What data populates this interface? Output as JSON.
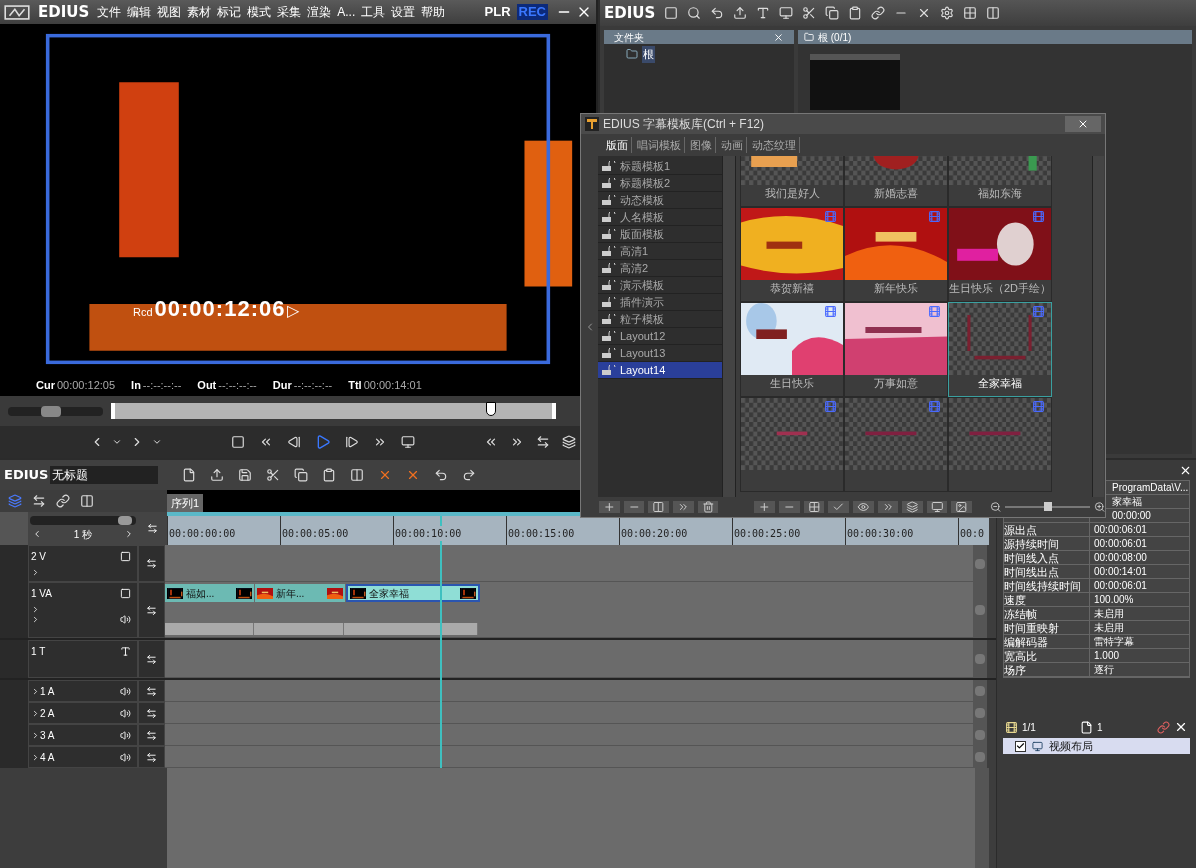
{
  "player": {
    "brand": "EDIUS",
    "menu": [
      "文件",
      "编辑",
      "视图",
      "素材",
      "标记",
      "模式",
      "采集",
      "渲染",
      "A...",
      "工具",
      "设置",
      "帮助"
    ],
    "modes": [
      {
        "label": "PLR",
        "selected": false
      },
      {
        "label": "REC",
        "selected": true
      }
    ],
    "overlay": {
      "label": "Rcd",
      "value": "00:00:12:06",
      "marker": "▷"
    },
    "timecodes": [
      {
        "label": "Cur",
        "value": "00:00:12:05"
      },
      {
        "label": "In",
        "value": "--:--:--:--"
      },
      {
        "label": "Out",
        "value": "--:--:--:--"
      },
      {
        "label": "Dur",
        "value": "--:--:--:--"
      },
      {
        "label": "Ttl",
        "value": "00:00:14:01"
      }
    ],
    "shuttle": {
      "level": 0.45
    },
    "scrubber": {
      "level": 0.86
    }
  },
  "bin": {
    "brand": "EDIUS",
    "folder_panel": {
      "title": "文件夹",
      "items": [
        {
          "label": "根"
        }
      ]
    },
    "clip_panel": {
      "title": "根 (0/1)"
    }
  },
  "template_library": {
    "title": "EDIUS 字幕模板库(Ctrl + F12)",
    "tabs": [
      {
        "label": "版面",
        "selected": true
      },
      {
        "label": "唱词模板",
        "selected": false
      },
      {
        "label": "图像",
        "selected": false
      },
      {
        "label": "动画",
        "selected": false
      },
      {
        "label": "动态纹理",
        "selected": false
      }
    ],
    "categories": [
      {
        "label": "标题模板1",
        "selected": false
      },
      {
        "label": "标题模板2",
        "selected": false
      },
      {
        "label": "动态模板",
        "selected": false
      },
      {
        "label": "人名模板",
        "selected": false
      },
      {
        "label": "版面模板",
        "selected": false
      },
      {
        "label": "高清1",
        "selected": false
      },
      {
        "label": "高清2",
        "selected": false
      },
      {
        "label": "演示模板",
        "selected": false
      },
      {
        "label": "插件演示",
        "selected": false
      },
      {
        "label": "粒子模板",
        "selected": false
      },
      {
        "label": "Layout12",
        "selected": false
      },
      {
        "label": "Layout13",
        "selected": false
      },
      {
        "label": "Layout14",
        "selected": true
      }
    ],
    "templates": [
      {
        "label": "我们是好人",
        "selected": false
      },
      {
        "label": "新婚志喜",
        "selected": false
      },
      {
        "label": "福如东海",
        "selected": false
      },
      {
        "label": "恭贺新禧",
        "selected": false
      },
      {
        "label": "新年快乐",
        "selected": false
      },
      {
        "label": "生日快乐（2D手绘）",
        "selected": false
      },
      {
        "label": "生日快乐",
        "selected": false
      },
      {
        "label": "万事如意",
        "selected": false
      },
      {
        "label": "全家幸福",
        "selected": true
      },
      {
        "selected": false
      },
      {
        "selected": false
      },
      {
        "selected": false
      }
    ],
    "zoom": {
      "level": 0.5
    }
  },
  "timeline": {
    "brand": "EDIUS",
    "project_name": "无标题",
    "sequence_tabs": [
      {
        "label": "序列1",
        "selected": true
      }
    ],
    "zoom": "1 秒",
    "zoom_slider": {
      "level": 0.9
    },
    "ruler": [
      "00:00:00:00",
      "00:00:05:00",
      "00:00:10:00",
      "00:00:15:00",
      "00:00:20:00",
      "00:00:25:00",
      "00:00:30:00",
      "00:0"
    ],
    "playhead": {
      "level": 0.338
    },
    "tracks": [
      {
        "name": "2 V",
        "kind": "video"
      },
      {
        "name": "1 VA",
        "kind": "videoaudio",
        "clips": [
          {
            "label": "福如...",
            "selected": false
          },
          {
            "label": "新年...",
            "selected": false
          },
          {
            "label": "全家幸福",
            "selected": true
          }
        ]
      },
      {
        "name": "1 T",
        "kind": "title"
      },
      {
        "name": "1 A",
        "kind": "audio"
      },
      {
        "name": "2 A",
        "kind": "audio"
      },
      {
        "name": "3 A",
        "kind": "audio"
      },
      {
        "name": "4 A",
        "kind": "audio"
      }
    ]
  },
  "info_panel": {
    "rows": [
      {
        "value": "ProgramData\\V..."
      },
      {
        "value": "家幸福"
      },
      {
        "value": "00:00:00"
      },
      {
        "label": "源出点",
        "value": "00:00:06:01"
      },
      {
        "label": "源持续时间",
        "value": "00:00:06:01"
      },
      {
        "label": "时间线入点",
        "value": "00:00:08:00"
      },
      {
        "label": "时间线出点",
        "value": "00:00:14:01"
      },
      {
        "label": "时间线持续时间",
        "value": "00:00:06:01"
      },
      {
        "label": "速度",
        "value": "100.00%"
      },
      {
        "label": "冻结帧",
        "value": "未启用"
      },
      {
        "label": "时间重映射",
        "value": "未启用"
      },
      {
        "label": "编解码器",
        "value": "雷特字幕"
      },
      {
        "label": "宽高比",
        "value": "1.000"
      },
      {
        "label": "场序",
        "value": "逐行"
      }
    ],
    "layer_count": "1/1",
    "filter_count": "1",
    "effects": [
      {
        "label": "视频布局",
        "checked": true
      }
    ]
  }
}
